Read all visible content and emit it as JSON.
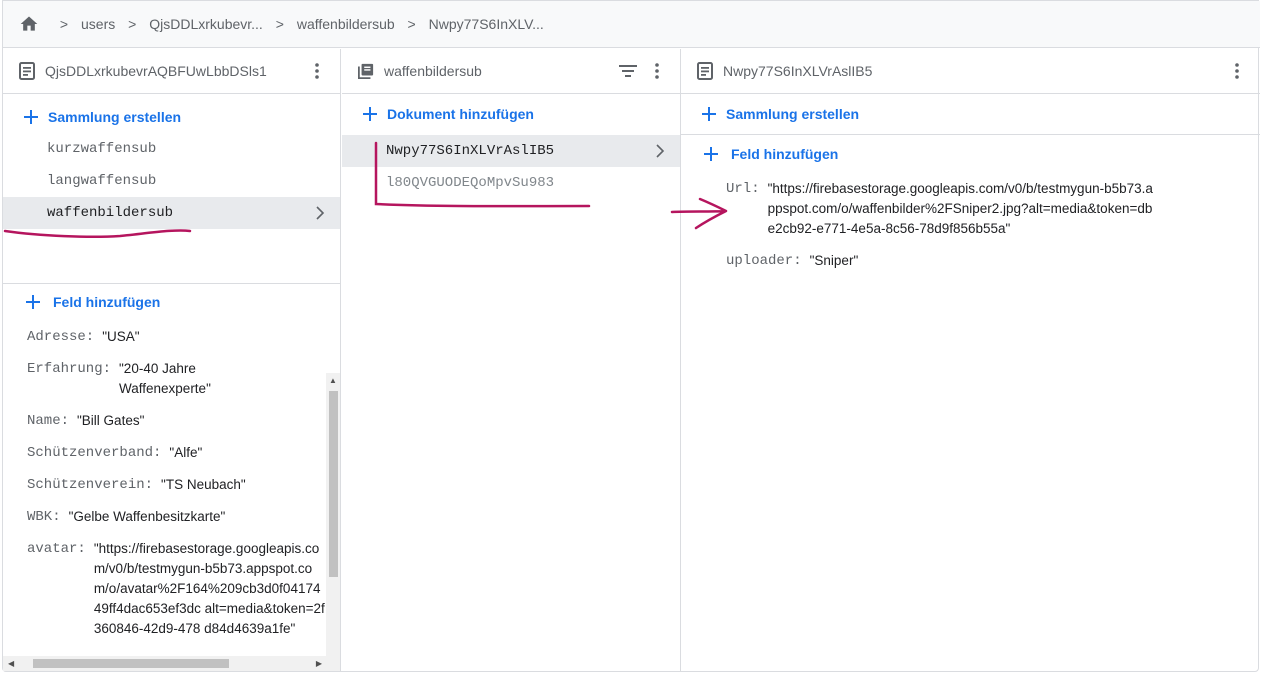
{
  "breadcrumb": {
    "items": [
      "users",
      "QjsDDLxrkubevr...",
      "waffenbildersub",
      "Nwpy77S6InXLV..."
    ]
  },
  "col1": {
    "title": "QjsDDLxrkubevrAQBFUwLbbDSls1",
    "add_collection": "Sammlung erstellen",
    "collections": [
      "kurzwaffensub",
      "langwaffensub",
      "waffenbildersub"
    ],
    "add_field": "Feld hinzufügen",
    "fields": [
      {
        "key": "Adresse:",
        "value": "\"USA\""
      },
      {
        "key": "Erfahrung:",
        "value": "\"20-40 Jahre Waffenexperte\""
      },
      {
        "key": "Name:",
        "value": "\"Bill Gates\""
      },
      {
        "key": "Schützenverband:",
        "value": "\"Alfe\""
      },
      {
        "key": "Schützenverein:",
        "value": "\"TS Neubach\""
      },
      {
        "key": "WBK:",
        "value": "\"Gelbe Waffenbesitzkarte\""
      },
      {
        "key": "avatar:",
        "value": "\"https://firebasestorage.googleapis.com/v0/b/testmygun-b5b73.appspot.com/o/avatar%2F164%209cb3d0f0417449ff4dac653ef3dc alt=media&token=2f360846-42d9-478 d84d4639a1fe\""
      }
    ]
  },
  "col2": {
    "title": "waffenbildersub",
    "add_document": "Dokument hinzufügen",
    "documents": [
      "Nwpy77S6InXLVrAslIB5",
      "l80QVGUODEQoMpvSu983"
    ]
  },
  "col3": {
    "title": "Nwpy77S6InXLVrAslIB5",
    "add_collection": "Sammlung erstellen",
    "add_field": "Feld hinzufügen",
    "fields": [
      {
        "key": "Url:",
        "value": "\"https://firebasestorage.googleapis.com/v0/b/testmygun-b5b73.appspot.com/o/waffenbilder%2FSniper2.jpg?alt=media&token=dbe2cb92-e771-4e5a-8c56-78d9f856b55a\""
      },
      {
        "key": "uploader:",
        "value": "\"Sniper\""
      }
    ]
  },
  "colors": {
    "accent": "#1a73e8",
    "annotation": "#b5155e",
    "selected_bg": "#e8eaed",
    "border": "#dadce0"
  }
}
